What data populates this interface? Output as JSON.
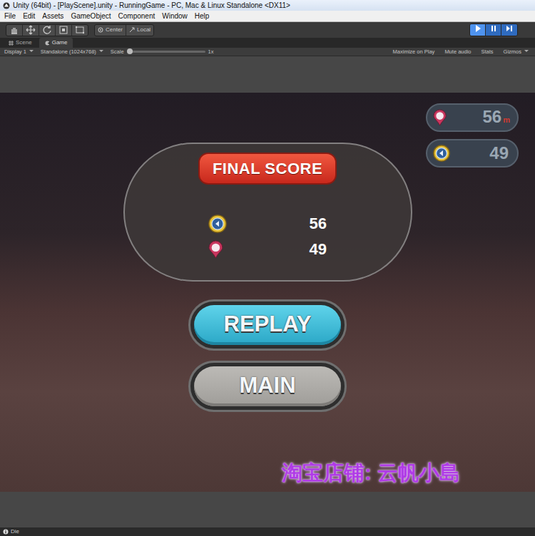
{
  "window": {
    "title": "Unity (64bit) - [PlayScene].unity - RunningGame - PC, Mac & Linux Standalone <DX11>"
  },
  "menu": [
    "File",
    "Edit",
    "Assets",
    "GameObject",
    "Component",
    "Window",
    "Help"
  ],
  "toolbar": {
    "pivot": "Center",
    "space": "Local",
    "play_buttons": [
      {
        "kind": "play",
        "on": true
      },
      {
        "kind": "pause",
        "on": false
      },
      {
        "kind": "step",
        "on": false
      }
    ]
  },
  "tabs": [
    {
      "label": "Scene",
      "selected": false
    },
    {
      "label": "Game",
      "selected": true
    }
  ],
  "game_toolbar": {
    "display": "Display 1",
    "resolution": "Standalone (1024x768)",
    "scale_label": "Scale",
    "scale_level": 0,
    "scale_value": "1x",
    "toggles": [
      {
        "label": "Maximize on Play",
        "on": false
      },
      {
        "label": "Mute audio",
        "on": false
      },
      {
        "label": "Stats",
        "on": false
      },
      {
        "label": "Gizmos",
        "on": false
      }
    ]
  },
  "hud": [
    {
      "kind": "distance",
      "value": "56",
      "unit": "m"
    },
    {
      "kind": "coin",
      "value": "49",
      "unit": ""
    }
  ],
  "final_score": {
    "title": "FINAL SCORE",
    "rows": [
      {
        "kind": "coin",
        "value": "56"
      },
      {
        "kind": "distance",
        "value": "49"
      }
    ]
  },
  "buttons": [
    {
      "label": "REPLAY",
      "kind": "primary"
    },
    {
      "label": "MAIN",
      "kind": "secondary"
    }
  ],
  "watermark": "淘宝店铺: 云帆小島",
  "status_bar": {
    "message": "Die"
  }
}
